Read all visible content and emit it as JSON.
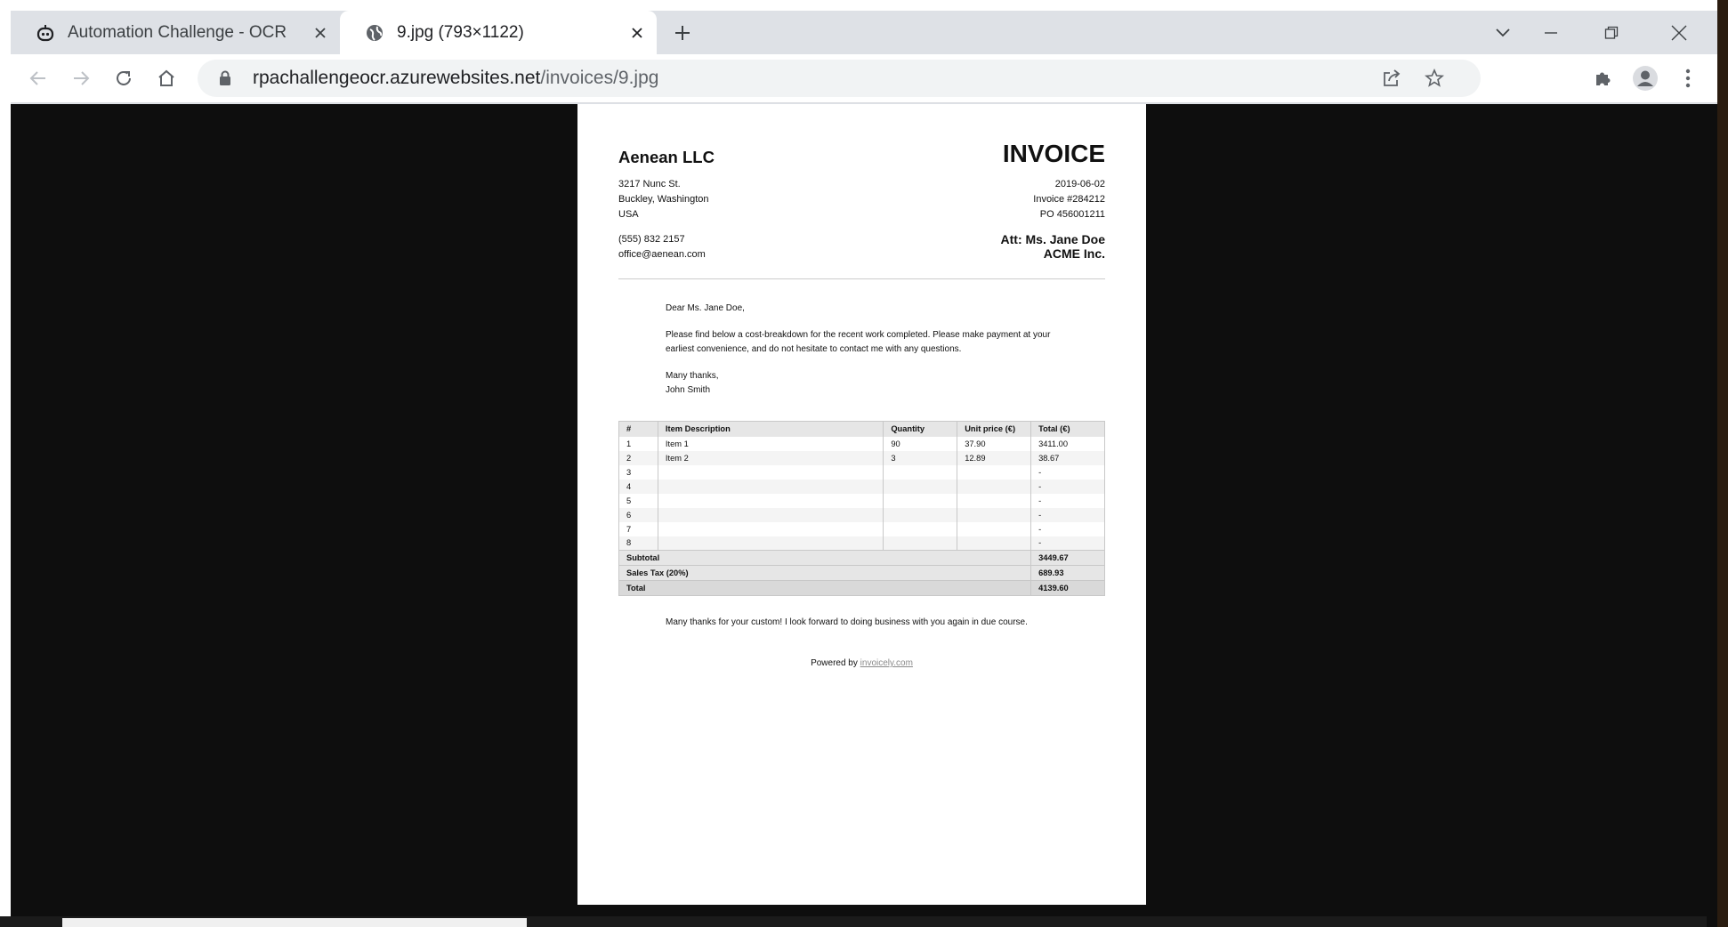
{
  "browser": {
    "tabs": [
      {
        "title": "Automation Challenge - OCR",
        "favicon": "robot-icon",
        "active": false
      },
      {
        "title": "9.jpg (793×1122)",
        "favicon": "globe-icon",
        "active": true
      }
    ],
    "url_host": "rpachallengeocr.azurewebsites.net",
    "url_path": "/invoices/9.jpg",
    "accent": "#dee1e6"
  },
  "invoice": {
    "company": "Aenean LLC",
    "title": "INVOICE",
    "address": [
      "3217 Nunc St.",
      "Buckley, Washington",
      "USA"
    ],
    "phone": "(555) 832 2157",
    "email": "office@aenean.com",
    "date": "2019-06-02",
    "number": "Invoice #284212",
    "po": "PO 456001211",
    "att": "Att: Ms. Jane Doe",
    "client": "ACME Inc.",
    "greeting": "Dear Ms. Jane Doe,",
    "body": "Please find below a cost-breakdown for the recent work completed. Please make payment at your earliest convenience, and do not hesitate to contact me with any questions.",
    "signoff": "Many thanks,",
    "signature": "John Smith",
    "table_headers": [
      "#",
      "Item Description",
      "Quantity",
      "Unit price (€)",
      "Total (€)"
    ],
    "rows": [
      [
        "1",
        "Item 1",
        "90",
        "37.90",
        "3411.00"
      ],
      [
        "2",
        "Item 2",
        "3",
        "12.89",
        "38.67"
      ],
      [
        "3",
        "",
        "",
        "",
        "-"
      ],
      [
        "4",
        "",
        "",
        "",
        "-"
      ],
      [
        "5",
        "",
        "",
        "",
        "-"
      ],
      [
        "6",
        "",
        "",
        "",
        "-"
      ],
      [
        "7",
        "",
        "",
        "",
        "-"
      ],
      [
        "8",
        "",
        "",
        "",
        "-"
      ]
    ],
    "subtotal_label": "Subtotal",
    "subtotal": "3449.67",
    "tax_label": "Sales Tax (20%)",
    "tax": "689.93",
    "total_label": "Total",
    "total": "4139.60",
    "closing": "Many thanks for your custom! I look forward to doing business with you again in due course.",
    "powered_prefix": "Powered by",
    "powered_link": "invoicely.com"
  }
}
